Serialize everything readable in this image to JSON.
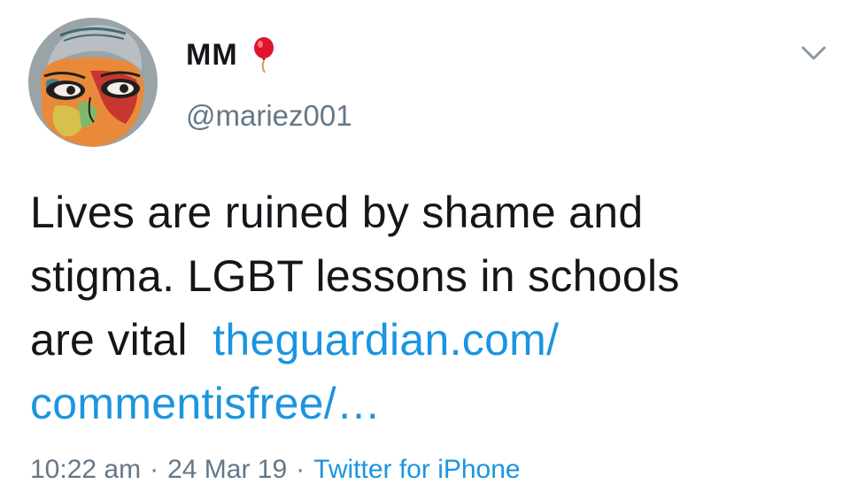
{
  "user": {
    "display_name": "MM",
    "name_emoji": "balloon-icon",
    "handle": "@mariez001"
  },
  "tweet": {
    "text_line1": "Lives are ruined by shame and",
    "text_line2": "stigma. LGBT lessons in schools",
    "text_line3_prefix": "are vital",
    "link_part1": "theguardian.com/",
    "link_part2": "commentisfree/…"
  },
  "meta": {
    "time": "10:22 am",
    "separator": "·",
    "date": "24 Mar 19",
    "source": "Twitter for iPhone"
  },
  "colors": {
    "text": "#14171a",
    "secondary": "#657786",
    "link": "#1b95e0",
    "balloon": "#e0142a"
  },
  "icons": {
    "menu": "chevron-down-icon",
    "avatar": "avatar-illustration"
  }
}
